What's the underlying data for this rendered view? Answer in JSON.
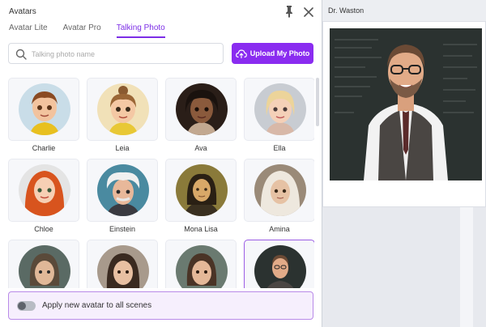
{
  "panel": {
    "title": "Avatars",
    "tabs": [
      {
        "label": "Avatar Lite"
      },
      {
        "label": "Avatar Pro"
      },
      {
        "label": "Talking Photo"
      }
    ],
    "active_tab": "Talking Photo",
    "search": {
      "placeholder": "Talking photo name",
      "value": ""
    },
    "upload_label": "Upload My Photo",
    "avatars": [
      {
        "name": "Charlie"
      },
      {
        "name": "Leia"
      },
      {
        "name": "Ava"
      },
      {
        "name": "Ella"
      },
      {
        "name": "Chloe"
      },
      {
        "name": "Einstein"
      },
      {
        "name": "Mona Lisa"
      },
      {
        "name": "Amina"
      },
      {
        "name": ""
      },
      {
        "name": ""
      },
      {
        "name": ""
      },
      {
        "name": ""
      }
    ],
    "selected_avatar_index": 11,
    "apply_toggle": {
      "label": "Apply new avatar to all scenes",
      "on": false
    }
  },
  "preview": {
    "title": "Dr. Waston"
  },
  "colors": {
    "accent": "#8a2cf0",
    "tab_active": "#7c2ee6"
  },
  "icons": [
    "pin-icon",
    "close-icon",
    "search-icon",
    "upload-cloud-icon"
  ]
}
